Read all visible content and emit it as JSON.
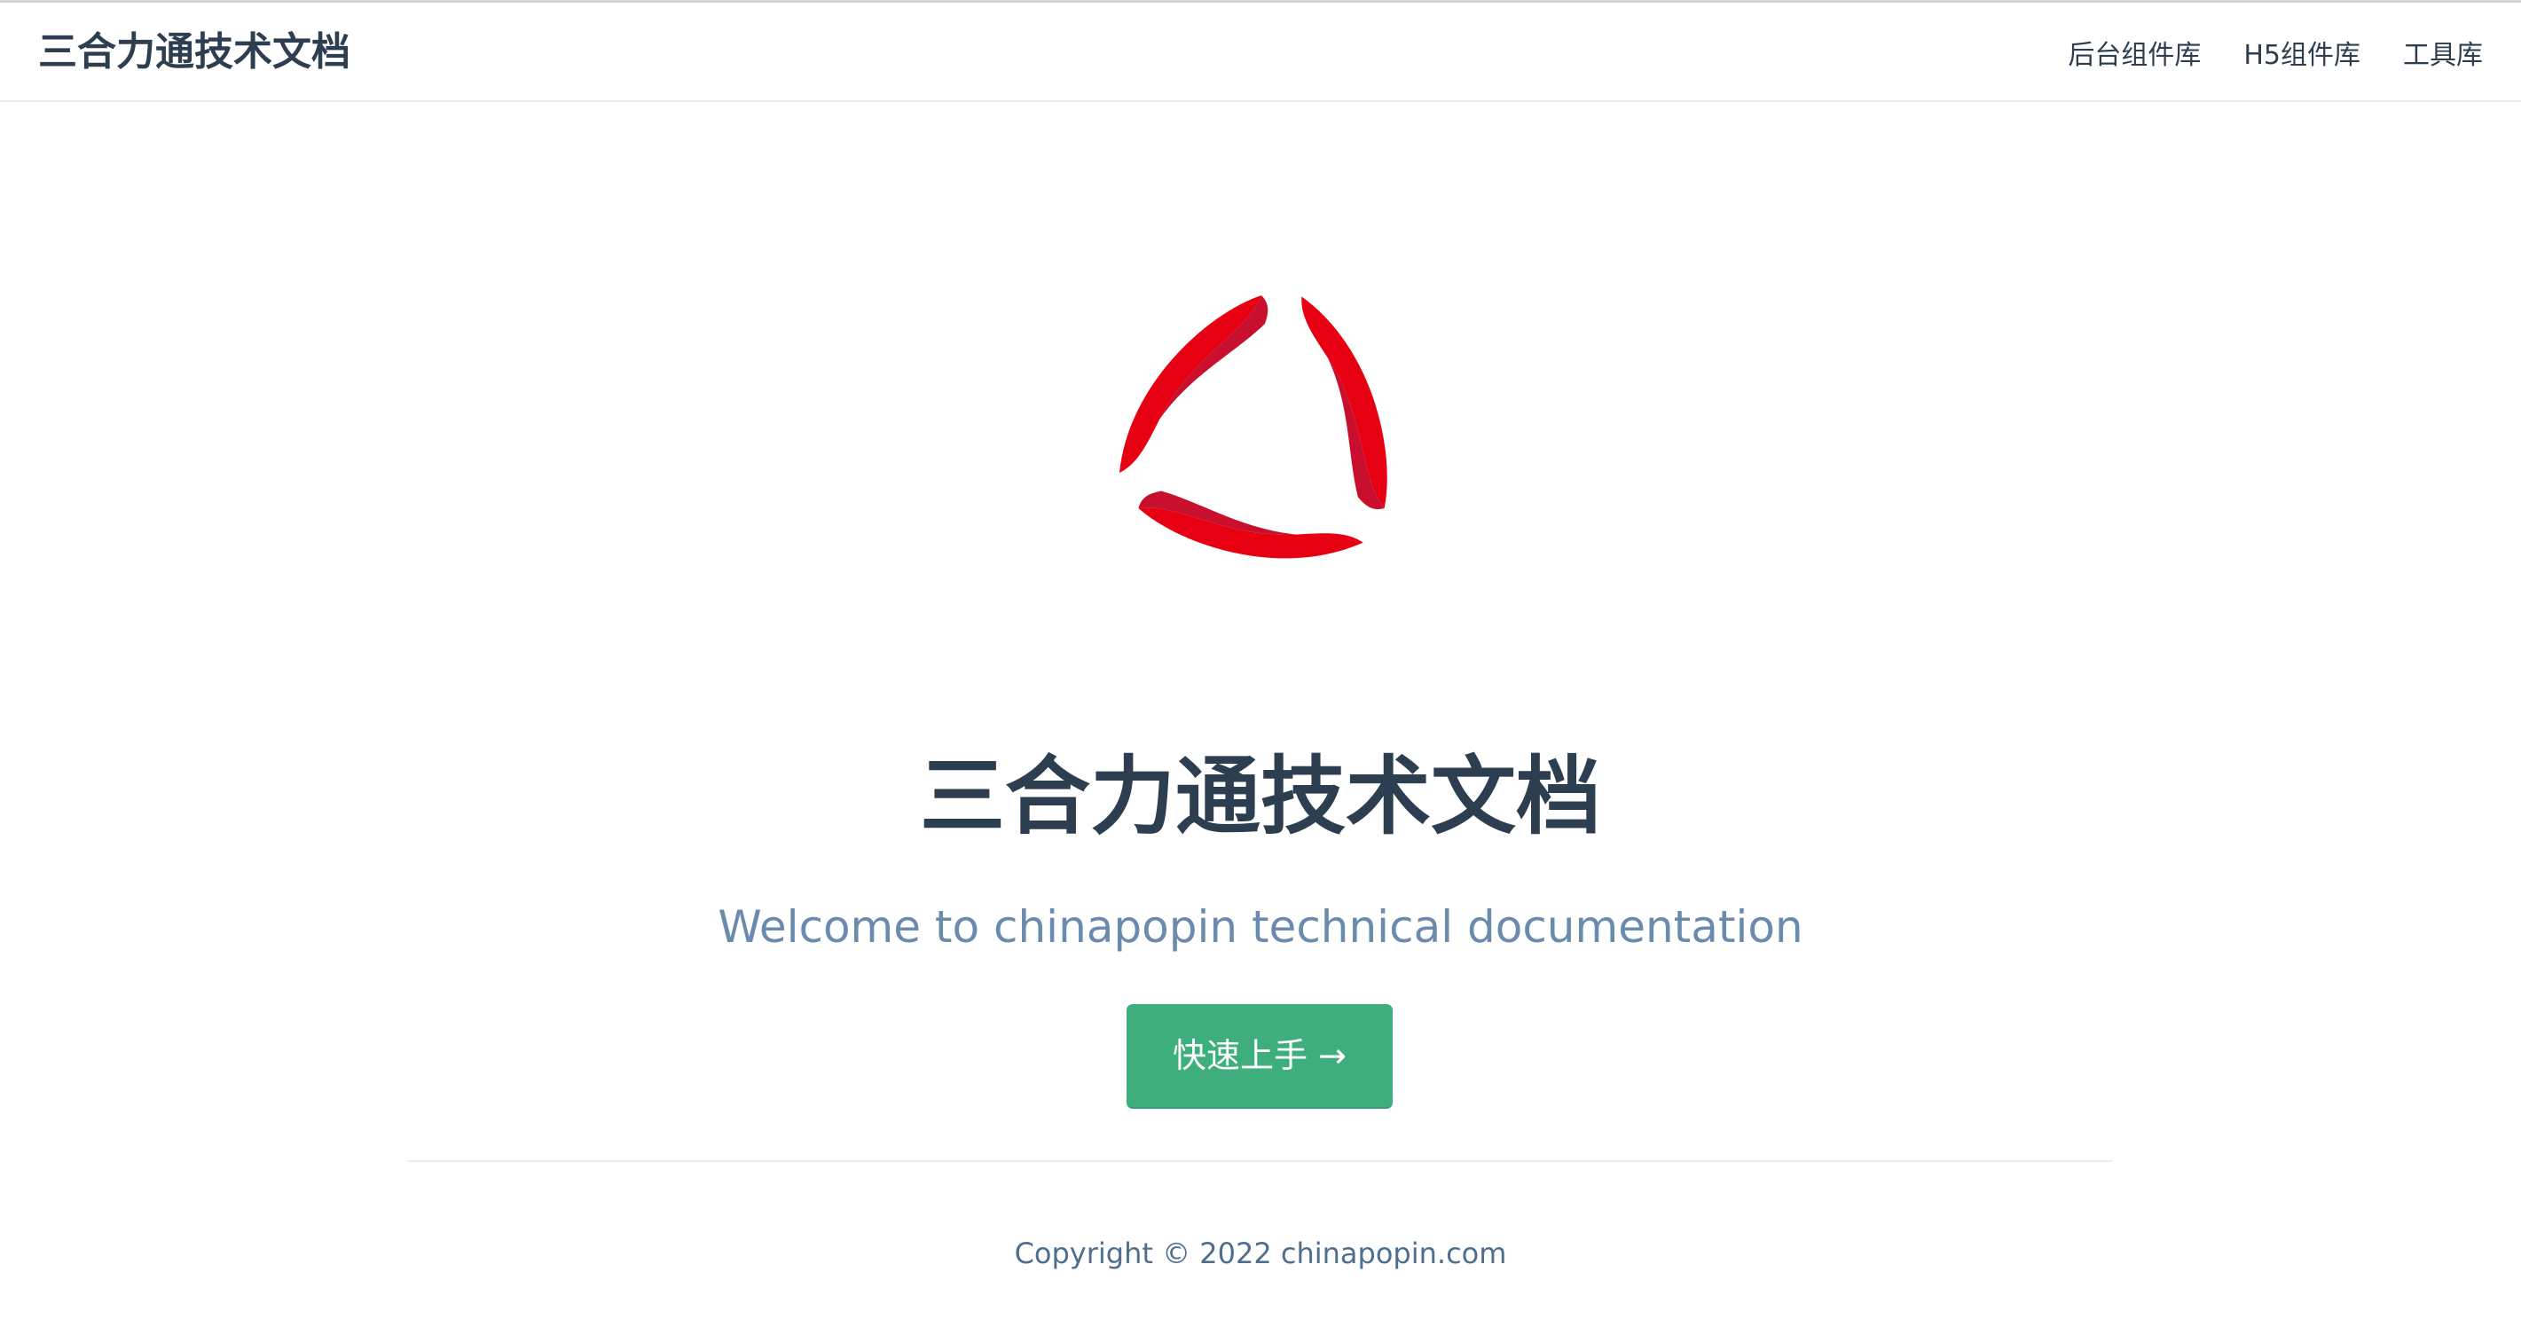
{
  "navbar": {
    "site_name": "三合力通技术文档",
    "links": [
      "后台组件库",
      "H5组件库",
      "工具库"
    ]
  },
  "hero": {
    "logo_icon": "red-triskelion-logo",
    "title": "三合力通技术文档",
    "description": "Welcome to chinapopin technical documentation",
    "action_label": "快速上手 →"
  },
  "footer": {
    "copyright": "Copyright © 2022 chinapopin.com"
  },
  "colors": {
    "brand_red": "#e60012",
    "brand_red_dark": "#c8102e",
    "accent_green": "#3eaf7c",
    "text_dark": "#2c3e50",
    "text_muted": "#6a8bad"
  }
}
